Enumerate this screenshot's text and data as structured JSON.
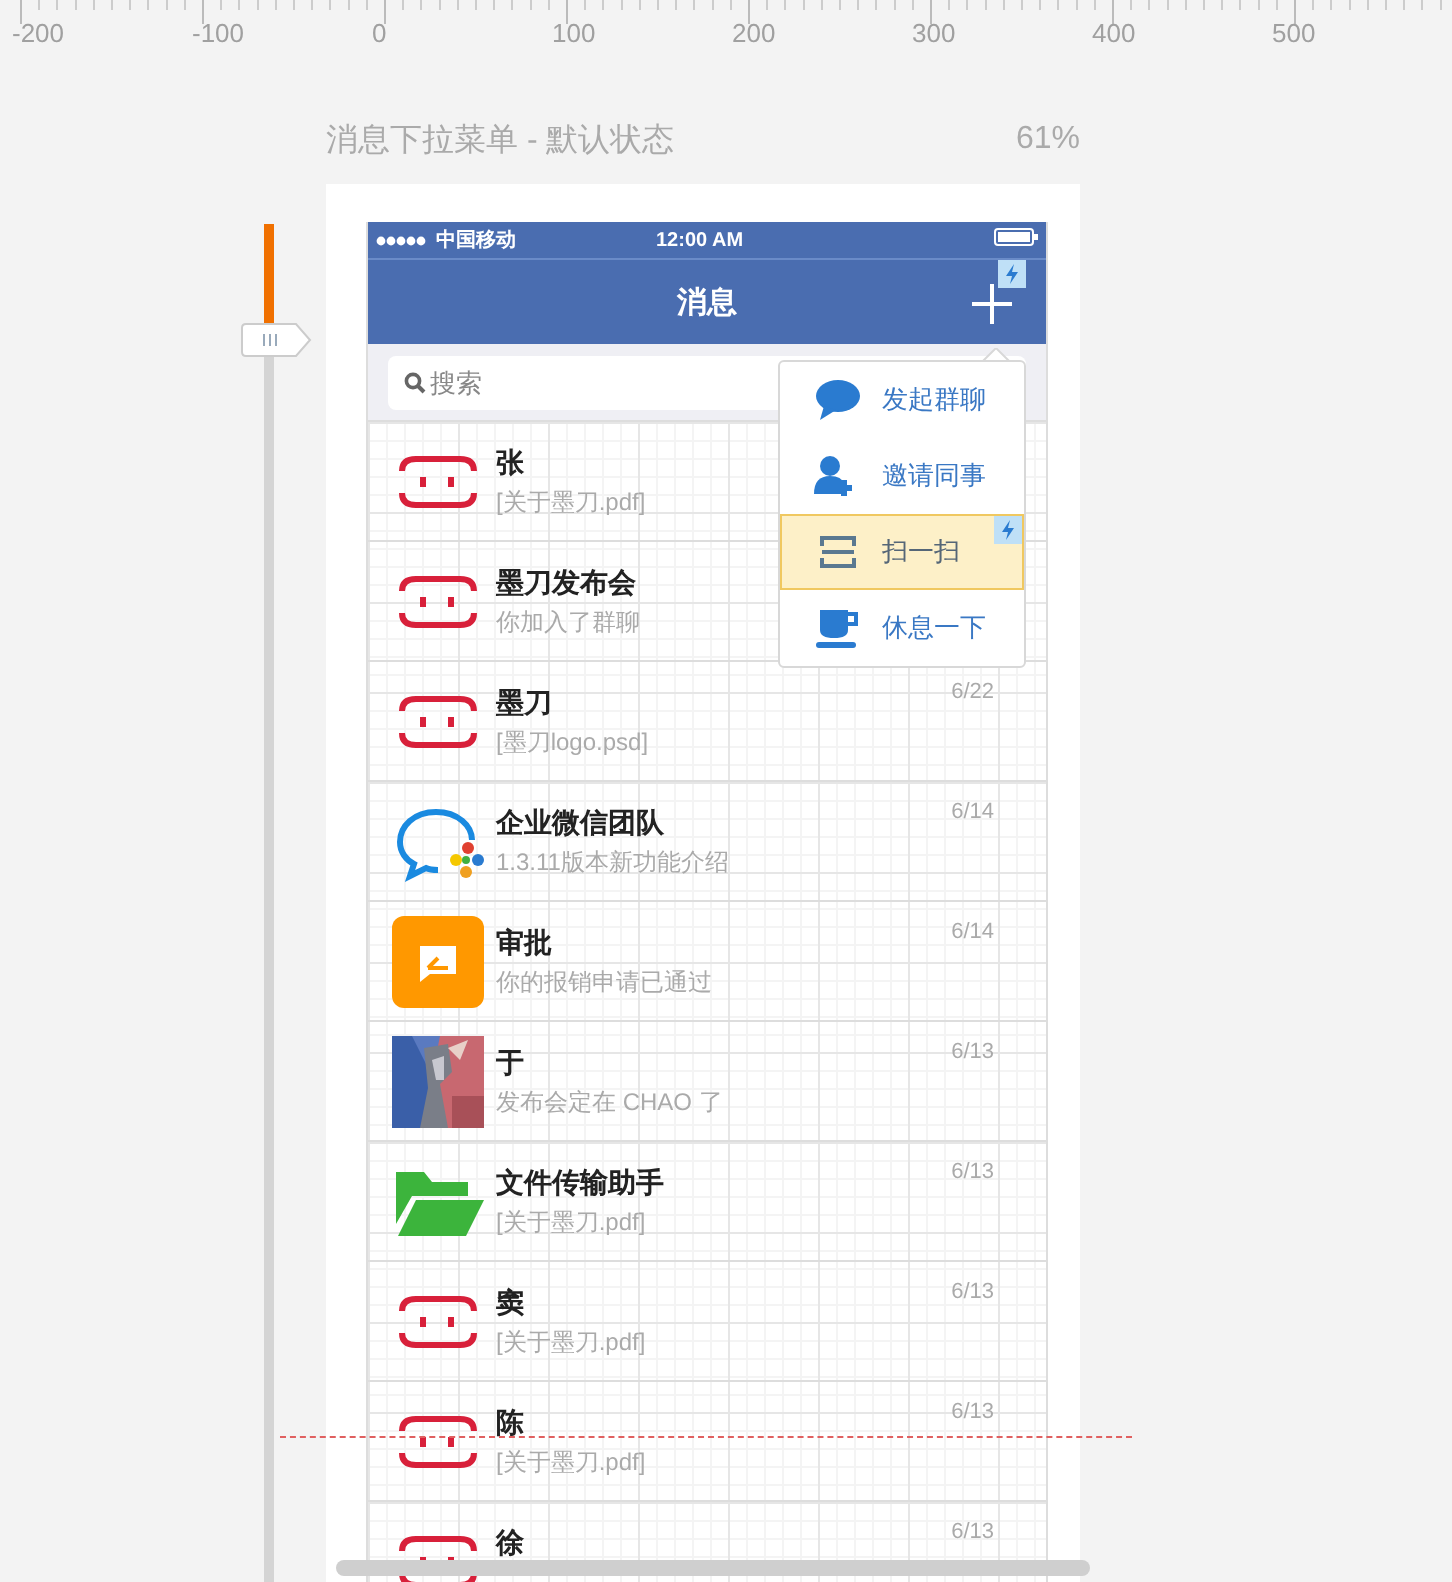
{
  "ruler": {
    "labels": [
      "-200",
      "-100",
      "0",
      "100",
      "200",
      "300",
      "400",
      "500"
    ]
  },
  "page": {
    "title": "消息下拉菜单 - 默认状态",
    "zoom": "61%"
  },
  "zoom_slider": {
    "level": 0.085
  },
  "phone": {
    "status_bar": {
      "carrier": "中国移动",
      "time": "12:00 AM"
    },
    "nav": {
      "title": "消息",
      "add_linked": true
    },
    "search": {
      "placeholder": "搜索"
    },
    "conversations": [
      {
        "kind": "face",
        "name": "张",
        "preview": "[关于墨刀.pdf]"
      },
      {
        "kind": "face",
        "name": "墨刀发布会",
        "preview": "你加入了群聊"
      },
      {
        "kind": "face",
        "name": "墨刀",
        "preview": "[墨刀logo.psd]",
        "time": "6/22"
      },
      {
        "kind": "bubble",
        "name": "企业微信团队",
        "preview": "1.3.11版本新功能介绍",
        "time": "6/14"
      },
      {
        "kind": "approval",
        "name": "审批",
        "preview": "你的报销申请已通过",
        "time": "6/14"
      },
      {
        "name": "于",
        "preview": "发布会定在 CHAO 了",
        "time": "6/13"
      },
      {
        "kind": "folder",
        "name": "文件传输助手",
        "preview": "[关于墨刀.pdf]",
        "time": "6/13"
      },
      {
        "kind": "face",
        "name": "窦",
        "preview": "[关于墨刀.pdf]",
        "time": "6/13"
      },
      {
        "kind": "face",
        "name": "陈",
        "preview": "[关于墨刀.pdf]",
        "time": "6/13"
      },
      {
        "kind": "face",
        "name": "徐",
        "time": "6/13"
      }
    ],
    "menu": {
      "items": [
        {
          "label": "发起群聊",
          "selected": false,
          "linked": false
        },
        {
          "label": "邀请同事",
          "selected": false,
          "linked": false
        },
        {
          "label": "扫一扫",
          "selected": true,
          "linked": true
        },
        {
          "label": "休息一下",
          "selected": false,
          "linked": false
        }
      ]
    }
  }
}
